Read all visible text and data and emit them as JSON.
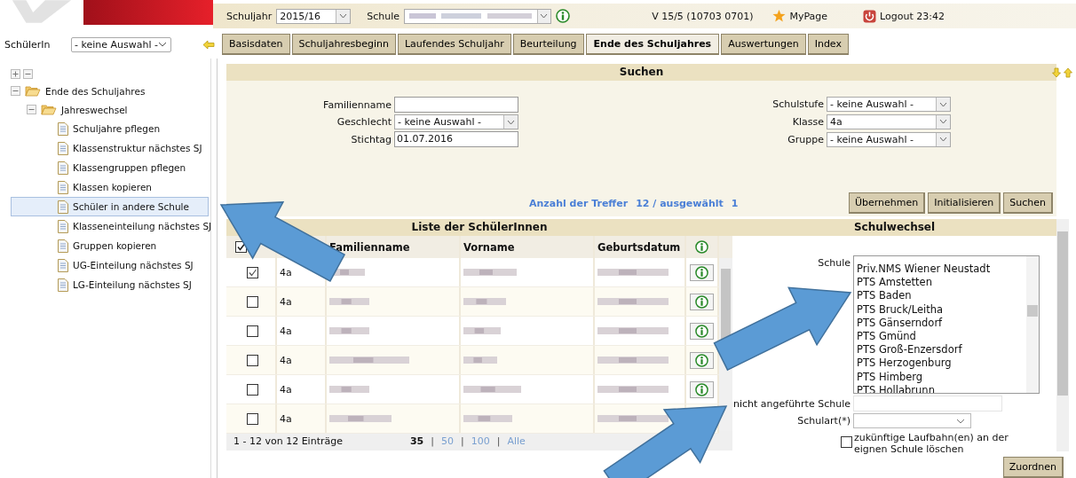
{
  "header": {
    "schuljahr_label": "Schuljahr",
    "schuljahr": "2015/16",
    "schule_label": "Schule",
    "version": "V 15/5 (10703 0701)",
    "mypage": "MyPage",
    "logout": "Logout 23:42"
  },
  "student_filter": {
    "label": "SchülerIn",
    "value": "- keine Auswahl -"
  },
  "tabs": [
    {
      "label": "Basisdaten",
      "selected": false
    },
    {
      "label": "Schuljahresbeginn",
      "selected": false
    },
    {
      "label": "Laufendes Schuljahr",
      "selected": false
    },
    {
      "label": "Beurteilung",
      "selected": false
    },
    {
      "label": "Ende des Schuljahres",
      "selected": true
    },
    {
      "label": "Auswertungen",
      "selected": false
    },
    {
      "label": "Index",
      "selected": false
    }
  ],
  "tree": [
    {
      "label": "Ende des Schuljahres",
      "expanded": true,
      "children": [
        {
          "label": "Jahreswechsel",
          "expanded": true,
          "children": [
            {
              "label": "Schuljahre pflegen",
              "selected": false
            },
            {
              "label": "Klassenstruktur nächstes SJ",
              "selected": false
            },
            {
              "label": "Klassengruppen pflegen",
              "selected": false
            },
            {
              "label": "Klassen kopieren",
              "selected": false
            },
            {
              "label": "Schüler in andere Schule",
              "selected": true
            },
            {
              "label": "Klasseneinteilung nächstes SJ",
              "selected": false
            },
            {
              "label": "Gruppen kopieren",
              "selected": false
            },
            {
              "label": "UG-Einteilung nächstes SJ",
              "selected": false
            },
            {
              "label": "LG-Einteilung nächstes SJ",
              "selected": false
            }
          ]
        }
      ]
    }
  ],
  "search": {
    "title": "Suchen",
    "fields_left": [
      {
        "label": "Familienname",
        "kind": "text"
      },
      {
        "label": "Geschlecht",
        "kind": "select",
        "value": "- keine Auswahl -"
      },
      {
        "label": "Stichtag",
        "kind": "text",
        "value": "01.07.2016"
      }
    ],
    "fields_right": [
      {
        "label": "Schulstufe",
        "kind": "select",
        "value": "- keine Auswahl -"
      },
      {
        "label": "Klasse",
        "kind": "select",
        "value": "4a"
      },
      {
        "label": "Gruppe",
        "kind": "select",
        "value": "- keine Auswahl -"
      }
    ],
    "hits_label": "Anzahl der Treffer",
    "hits": "12 / ausgewählt",
    "selected_count": "1",
    "buttons": [
      "Übernehmen",
      "Initialisieren",
      "Suchen"
    ]
  },
  "list": {
    "title": "Liste der SchülerInnen",
    "select_all_checked": true,
    "columns": [
      "Familienname",
      "Vorname",
      "Geburtsdatum"
    ],
    "rows": [
      {
        "checked": true,
        "klasse": "4a",
        "info_button": true
      },
      {
        "checked": false,
        "klasse": "4a",
        "info_button": true
      },
      {
        "checked": false,
        "klasse": "4a",
        "info_button": true
      },
      {
        "checked": false,
        "klasse": "4a",
        "info_button": true
      },
      {
        "checked": false,
        "klasse": "4a",
        "info_button": true
      },
      {
        "checked": false,
        "klasse": "4a",
        "info_button": false
      }
    ],
    "range": "1 - 12 von 12 Einträge",
    "page_size_separator": "|",
    "page_sizes": [
      {
        "label": "35",
        "selected": true
      },
      {
        "label": "50",
        "selected": false
      },
      {
        "label": "100",
        "selected": false
      },
      {
        "label": "Alle",
        "selected": false
      }
    ]
  },
  "schulwechsel": {
    "title": "Schulwechsel",
    "schule_label": "Schule",
    "schools": [
      "Priv.NMS Wiener Neustadt",
      "PTS Amstetten",
      "PTS Baden",
      "PTS Bruck/Leitha",
      "PTS Gänserndorf",
      "PTS Gmünd",
      "PTS Groß-Enzersdorf",
      "PTS Herzogenburg",
      "PTS Himberg",
      "PTS Hollabrunn"
    ],
    "other_label": "nicht angeführte Schule",
    "schulart_label": "Schulart(*)",
    "delete_option": {
      "label": "zukünftige Laufbahn(en) an der eignen Schule löschen",
      "checked": false
    },
    "button": "Zuordnen"
  },
  "annotation_arrows": [
    {
      "kind": "arrow"
    },
    {
      "kind": "arrow"
    },
    {
      "kind": "arrow"
    }
  ]
}
